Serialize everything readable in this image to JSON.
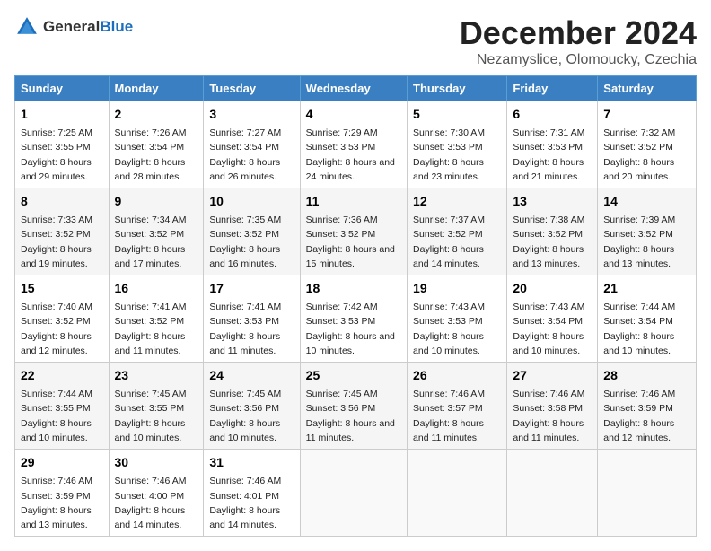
{
  "logo": {
    "general": "General",
    "blue": "Blue"
  },
  "title": "December 2024",
  "subtitle": "Nezamyslice, Olomoucky, Czechia",
  "headers": [
    "Sunday",
    "Monday",
    "Tuesday",
    "Wednesday",
    "Thursday",
    "Friday",
    "Saturday"
  ],
  "weeks": [
    [
      {
        "day": "1",
        "sunrise": "Sunrise: 7:25 AM",
        "sunset": "Sunset: 3:55 PM",
        "daylight": "Daylight: 8 hours and 29 minutes."
      },
      {
        "day": "2",
        "sunrise": "Sunrise: 7:26 AM",
        "sunset": "Sunset: 3:54 PM",
        "daylight": "Daylight: 8 hours and 28 minutes."
      },
      {
        "day": "3",
        "sunrise": "Sunrise: 7:27 AM",
        "sunset": "Sunset: 3:54 PM",
        "daylight": "Daylight: 8 hours and 26 minutes."
      },
      {
        "day": "4",
        "sunrise": "Sunrise: 7:29 AM",
        "sunset": "Sunset: 3:53 PM",
        "daylight": "Daylight: 8 hours and 24 minutes."
      },
      {
        "day": "5",
        "sunrise": "Sunrise: 7:30 AM",
        "sunset": "Sunset: 3:53 PM",
        "daylight": "Daylight: 8 hours and 23 minutes."
      },
      {
        "day": "6",
        "sunrise": "Sunrise: 7:31 AM",
        "sunset": "Sunset: 3:53 PM",
        "daylight": "Daylight: 8 hours and 21 minutes."
      },
      {
        "day": "7",
        "sunrise": "Sunrise: 7:32 AM",
        "sunset": "Sunset: 3:52 PM",
        "daylight": "Daylight: 8 hours and 20 minutes."
      }
    ],
    [
      {
        "day": "8",
        "sunrise": "Sunrise: 7:33 AM",
        "sunset": "Sunset: 3:52 PM",
        "daylight": "Daylight: 8 hours and 19 minutes."
      },
      {
        "day": "9",
        "sunrise": "Sunrise: 7:34 AM",
        "sunset": "Sunset: 3:52 PM",
        "daylight": "Daylight: 8 hours and 17 minutes."
      },
      {
        "day": "10",
        "sunrise": "Sunrise: 7:35 AM",
        "sunset": "Sunset: 3:52 PM",
        "daylight": "Daylight: 8 hours and 16 minutes."
      },
      {
        "day": "11",
        "sunrise": "Sunrise: 7:36 AM",
        "sunset": "Sunset: 3:52 PM",
        "daylight": "Daylight: 8 hours and 15 minutes."
      },
      {
        "day": "12",
        "sunrise": "Sunrise: 7:37 AM",
        "sunset": "Sunset: 3:52 PM",
        "daylight": "Daylight: 8 hours and 14 minutes."
      },
      {
        "day": "13",
        "sunrise": "Sunrise: 7:38 AM",
        "sunset": "Sunset: 3:52 PM",
        "daylight": "Daylight: 8 hours and 13 minutes."
      },
      {
        "day": "14",
        "sunrise": "Sunrise: 7:39 AM",
        "sunset": "Sunset: 3:52 PM",
        "daylight": "Daylight: 8 hours and 13 minutes."
      }
    ],
    [
      {
        "day": "15",
        "sunrise": "Sunrise: 7:40 AM",
        "sunset": "Sunset: 3:52 PM",
        "daylight": "Daylight: 8 hours and 12 minutes."
      },
      {
        "day": "16",
        "sunrise": "Sunrise: 7:41 AM",
        "sunset": "Sunset: 3:52 PM",
        "daylight": "Daylight: 8 hours and 11 minutes."
      },
      {
        "day": "17",
        "sunrise": "Sunrise: 7:41 AM",
        "sunset": "Sunset: 3:53 PM",
        "daylight": "Daylight: 8 hours and 11 minutes."
      },
      {
        "day": "18",
        "sunrise": "Sunrise: 7:42 AM",
        "sunset": "Sunset: 3:53 PM",
        "daylight": "Daylight: 8 hours and 10 minutes."
      },
      {
        "day": "19",
        "sunrise": "Sunrise: 7:43 AM",
        "sunset": "Sunset: 3:53 PM",
        "daylight": "Daylight: 8 hours and 10 minutes."
      },
      {
        "day": "20",
        "sunrise": "Sunrise: 7:43 AM",
        "sunset": "Sunset: 3:54 PM",
        "daylight": "Daylight: 8 hours and 10 minutes."
      },
      {
        "day": "21",
        "sunrise": "Sunrise: 7:44 AM",
        "sunset": "Sunset: 3:54 PM",
        "daylight": "Daylight: 8 hours and 10 minutes."
      }
    ],
    [
      {
        "day": "22",
        "sunrise": "Sunrise: 7:44 AM",
        "sunset": "Sunset: 3:55 PM",
        "daylight": "Daylight: 8 hours and 10 minutes."
      },
      {
        "day": "23",
        "sunrise": "Sunrise: 7:45 AM",
        "sunset": "Sunset: 3:55 PM",
        "daylight": "Daylight: 8 hours and 10 minutes."
      },
      {
        "day": "24",
        "sunrise": "Sunrise: 7:45 AM",
        "sunset": "Sunset: 3:56 PM",
        "daylight": "Daylight: 8 hours and 10 minutes."
      },
      {
        "day": "25",
        "sunrise": "Sunrise: 7:45 AM",
        "sunset": "Sunset: 3:56 PM",
        "daylight": "Daylight: 8 hours and 11 minutes."
      },
      {
        "day": "26",
        "sunrise": "Sunrise: 7:46 AM",
        "sunset": "Sunset: 3:57 PM",
        "daylight": "Daylight: 8 hours and 11 minutes."
      },
      {
        "day": "27",
        "sunrise": "Sunrise: 7:46 AM",
        "sunset": "Sunset: 3:58 PM",
        "daylight": "Daylight: 8 hours and 11 minutes."
      },
      {
        "day": "28",
        "sunrise": "Sunrise: 7:46 AM",
        "sunset": "Sunset: 3:59 PM",
        "daylight": "Daylight: 8 hours and 12 minutes."
      }
    ],
    [
      {
        "day": "29",
        "sunrise": "Sunrise: 7:46 AM",
        "sunset": "Sunset: 3:59 PM",
        "daylight": "Daylight: 8 hours and 13 minutes."
      },
      {
        "day": "30",
        "sunrise": "Sunrise: 7:46 AM",
        "sunset": "Sunset: 4:00 PM",
        "daylight": "Daylight: 8 hours and 14 minutes."
      },
      {
        "day": "31",
        "sunrise": "Sunrise: 7:46 AM",
        "sunset": "Sunset: 4:01 PM",
        "daylight": "Daylight: 8 hours and 14 minutes."
      },
      null,
      null,
      null,
      null
    ]
  ]
}
